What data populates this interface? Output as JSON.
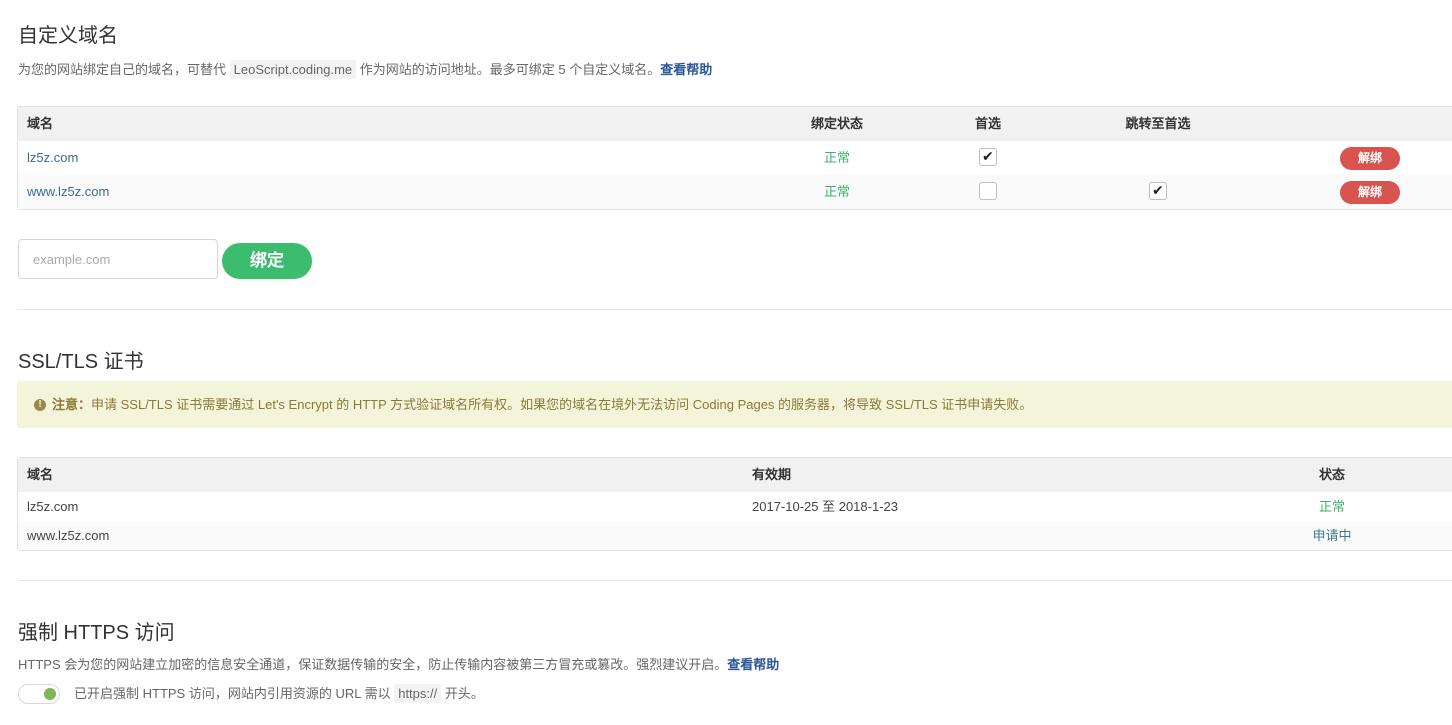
{
  "custom_domain": {
    "title": "自定义域名",
    "desc_prefix": "为您的网站绑定自己的域名，可替代",
    "default_domain": "LeoScript.coding.me",
    "desc_suffix": "作为网站的访问地址。最多可绑定 5 个自定义域名。",
    "help_link": "查看帮助",
    "table": {
      "headers": {
        "domain": "域名",
        "status": "绑定状态",
        "primary": "首选",
        "redirect": "跳转至首选"
      },
      "rows": [
        {
          "domain": "lz5z.com",
          "status": "正常",
          "primary": true,
          "redirect": false,
          "action": "解绑"
        },
        {
          "domain": "www.lz5z.com",
          "status": "正常",
          "primary": false,
          "redirect": true,
          "action": "解绑"
        }
      ]
    },
    "input_placeholder": "example.com",
    "bind_button": "绑定"
  },
  "ssl": {
    "title": "SSL/TLS 证书",
    "notice_label": "注意：",
    "notice_text": "申请 SSL/TLS 证书需要通过 Let's Encrypt 的 HTTP 方式验证域名所有权。如果您的域名在境外无法访问 Coding Pages 的服务器，将导致 SSL/TLS 证书申请失败。",
    "table": {
      "headers": {
        "domain": "域名",
        "validity": "有效期",
        "status": "状态"
      },
      "rows": [
        {
          "domain": "lz5z.com",
          "validity": "2017-10-25 至 2018-1-23",
          "status": "正常"
        },
        {
          "domain": "www.lz5z.com",
          "validity": "",
          "status": "申请中"
        }
      ]
    }
  },
  "https": {
    "title": "强制 HTTPS 访问",
    "desc": "HTTPS 会为您的网站建立加密的信息安全通道，保证数据传输的安全，防止传输内容被第三方冒充或篡改。强烈建议开启。",
    "help_link": "查看帮助",
    "toggle_on": true,
    "toggle_prefix": "已开启强制 HTTPS 访问，网站内引用资源的 URL 需以",
    "toggle_code": "https://",
    "toggle_suffix": "开头。"
  },
  "colors": {
    "ok": "#3fb16b",
    "danger": "#d9534f",
    "primary_green": "#3cbc6e",
    "link": "#2b5797",
    "notice_bg": "#f4f4da"
  }
}
